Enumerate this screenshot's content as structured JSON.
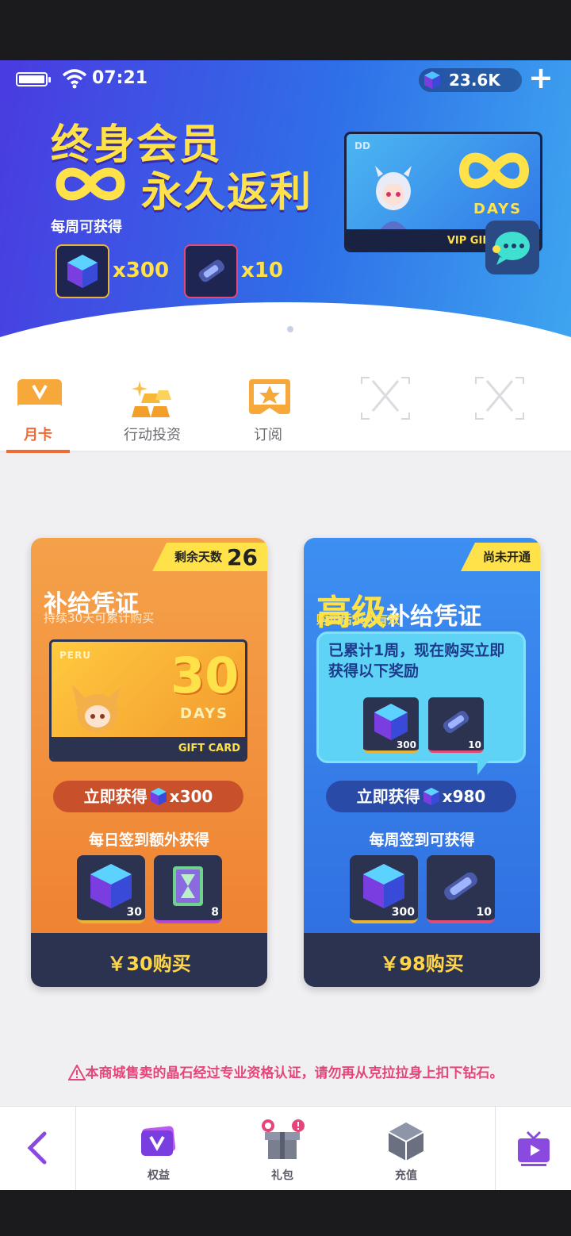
{
  "status": {
    "time": "07:21",
    "currency": "23.6K"
  },
  "banner": {
    "title_line1": "终身会员",
    "title_line2": "永久返利",
    "subtitle": "每周可获得",
    "item1_count": "x300",
    "item2_count": "x10",
    "card_days": "DAYS",
    "card_strip": "VIP GIFT CARD",
    "card_corner": "DD"
  },
  "tabs": [
    {
      "label": "月卡"
    },
    {
      "label": "行动投资"
    },
    {
      "label": "订阅"
    },
    {
      "label": ""
    },
    {
      "label": ""
    }
  ],
  "card_monthly": {
    "tag_label": "剩余天数",
    "tag_value": "26",
    "title": "补给凭证",
    "subtitle": "持续30天可累计购买",
    "gift_corner": "PERU",
    "gift_big": "30",
    "gift_days": "DAYS",
    "gift_strip": "GIFT CARD",
    "instant_prefix": "立即获得",
    "instant_count": "x300",
    "daily_label": "每日签到额外获得",
    "reward1_count": "30",
    "reward2_count": "8",
    "price": "￥30购买"
  },
  "card_premium": {
    "tag_label": "尚未开通",
    "title_big": "高级",
    "title_rest": "补给凭证",
    "subtitle": "购买后永久有效",
    "bubble_text": "已累计1周，现在购买立即获得以下奖励",
    "bubble_item1": "300",
    "bubble_item2": "10",
    "instant_prefix": "立即获得",
    "instant_count": "x980",
    "weekly_label": "每周签到可获得",
    "reward1_count": "300",
    "reward2_count": "10",
    "price": "￥98购买"
  },
  "notice": "本商城售卖的晶石经过专业资格认证，请勿再从克拉拉身上扣下钻石。",
  "nav": {
    "item1": "权益",
    "item2": "礼包",
    "item3": "充值"
  },
  "colors": {
    "accent_orange": "#ef6a34",
    "gold": "#ffe24a",
    "blue": "#2f6cdf"
  }
}
